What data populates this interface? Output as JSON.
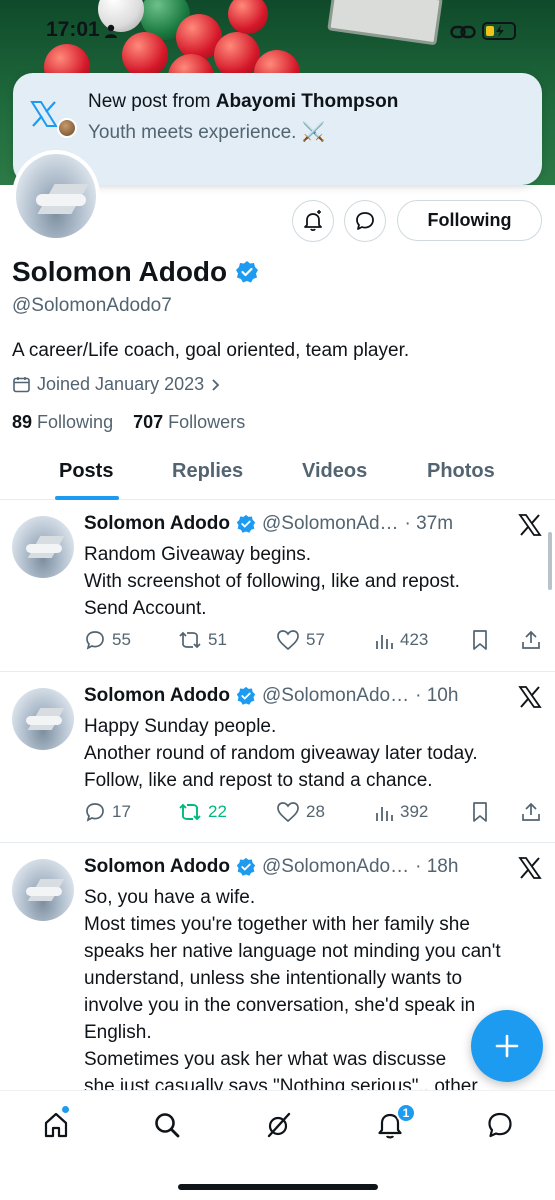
{
  "status_bar": {
    "time": "17:01"
  },
  "notification": {
    "prefix": "New post from",
    "author": "Abayomi Thompson",
    "body": "Youth meets experience. ⚔️"
  },
  "profile": {
    "name": "Solomon Adodo",
    "handle": "@SolomonAdodo7",
    "bio": "A career/Life coach, goal oriented, team player.",
    "joined": "Joined January 2023",
    "following_count": "89",
    "following_label": "Following",
    "followers_count": "707",
    "followers_label": "Followers",
    "follow_button": "Following"
  },
  "tabs": [
    {
      "label": "Posts",
      "active": true
    },
    {
      "label": "Replies"
    },
    {
      "label": "Videos"
    },
    {
      "label": "Photos"
    }
  ],
  "posts": [
    {
      "name": "Solomon Adodo",
      "handle": "@SolomonAd…",
      "time": "· 37m",
      "lines": [
        "Random Giveaway begins.",
        "With screenshot of following, like and repost.",
        "Send Account."
      ],
      "replies": "55",
      "reposts": "51",
      "likes": "57",
      "views": "423"
    },
    {
      "name": "Solomon Adodo",
      "handle": "@SolomonAdo…",
      "time": "· 10h",
      "lines": [
        "Happy Sunday people.",
        "Another round of random giveaway later today.",
        "Follow, like and repost to stand a chance."
      ],
      "replies": "17",
      "reposts": "22",
      "likes": "28",
      "views": "392"
    },
    {
      "name": "Solomon Adodo",
      "handle": "@SolomonAdo…",
      "time": "· 18h",
      "lines": [
        "So,  you have a wife.",
        "Most times you're together with her family she",
        "speaks her native language not minding you can't",
        "understand, unless she intentionally wants to",
        "involve you in the conversation, she'd speak in",
        "English.",
        "Sometimes you ask her what was discusse",
        "she just casually says \"Nothing serious\"., other"
      ]
    }
  ],
  "bottom_nav": {
    "notifications_badge": "1"
  },
  "colors": {
    "accent": "#1d9bf0",
    "repost_active": "#00ba7c",
    "secondary_text": "#536471"
  }
}
